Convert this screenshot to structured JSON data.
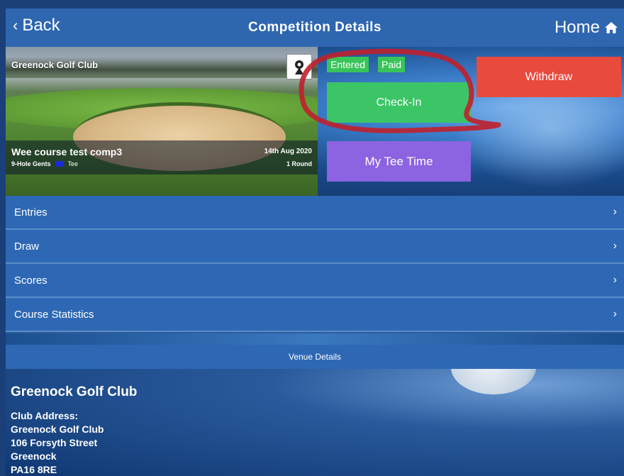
{
  "navbar": {
    "back_label": "Back",
    "title": "Competition Details",
    "home_label": "Home"
  },
  "hero": {
    "club_name": "Greenock Golf Club",
    "competition_name": "Wee course test comp3",
    "competition_format": "9-Hole Gents",
    "tee_label": "Tee",
    "tee_color": "#1a2bd6",
    "date": "14th Aug 2020",
    "rounds": "1 Round",
    "badges": [
      "Entered",
      "Paid"
    ],
    "checkin_label": "Check-In",
    "withdraw_label": "Withdraw",
    "tee_time_label": "My Tee Time"
  },
  "menu": {
    "items": [
      {
        "label": "Entries"
      },
      {
        "label": "Draw"
      },
      {
        "label": "Scores"
      },
      {
        "label": "Course Statistics"
      }
    ]
  },
  "venue": {
    "header": "Venue Details",
    "name": "Greenock Golf Club",
    "address_label": "Club Address:",
    "address_lines": [
      "Greenock Golf Club",
      "106 Forsyth Street",
      "Greenock",
      "PA16 8RE"
    ]
  },
  "colors": {
    "nav": "#2e66b0",
    "checkin": "#3bc566",
    "withdraw": "#e84a3e",
    "tee_time": "#8c63e0",
    "badge": "#39c459",
    "annotation": "#c0202c"
  }
}
